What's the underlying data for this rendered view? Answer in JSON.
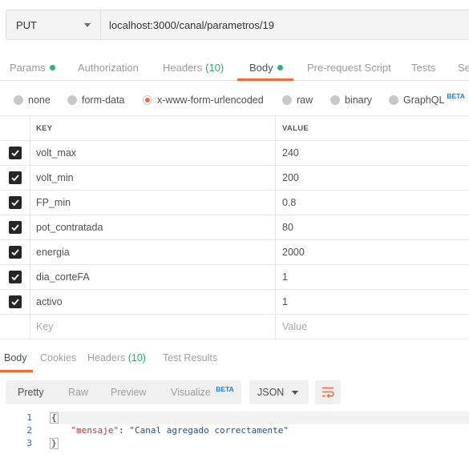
{
  "request": {
    "method": "PUT",
    "url": "localhost:3000/canal/parametros/19"
  },
  "request_tabs": [
    {
      "label": "Params",
      "dot": true
    },
    {
      "label": "Authorization"
    },
    {
      "label": "Headers",
      "count": "(10)"
    },
    {
      "label": "Body",
      "dot": true,
      "active": true
    },
    {
      "label": "Pre-request Script"
    },
    {
      "label": "Tests"
    },
    {
      "label": "Se"
    }
  ],
  "body_types": [
    {
      "label": "none"
    },
    {
      "label": "form-data"
    },
    {
      "label": "x-www-form-urlencoded",
      "selected": true
    },
    {
      "label": "raw"
    },
    {
      "label": "binary"
    },
    {
      "label": "GraphQL",
      "badge": "BETA"
    }
  ],
  "table": {
    "key_header": "KEY",
    "value_header": "VALUE",
    "rows": [
      {
        "key": "volt_max",
        "value": "240",
        "checked": true
      },
      {
        "key": "volt_min",
        "value": "200",
        "checked": true
      },
      {
        "key": "FP_min",
        "value": "0.8",
        "checked": true
      },
      {
        "key": "pot_contratada",
        "value": "80",
        "checked": true
      },
      {
        "key": "energia",
        "value": "2000",
        "checked": true
      },
      {
        "key": "dia_corteFA",
        "value": "1",
        "checked": true
      },
      {
        "key": "activo",
        "value": "1",
        "checked": true
      }
    ],
    "key_placeholder": "Key",
    "value_placeholder": "Value"
  },
  "response_tabs": [
    {
      "label": "Body",
      "active": true
    },
    {
      "label": "Cookies"
    },
    {
      "label": "Headers",
      "count": "(10)"
    },
    {
      "label": "Test Results"
    }
  ],
  "response_toolbar": {
    "views": [
      "Pretty",
      "Raw",
      "Preview",
      "Visualize"
    ],
    "visualize_badge": "BETA",
    "format": "JSON"
  },
  "response_body": {
    "line_numbers": [
      "1",
      "2",
      "3"
    ],
    "open": "{",
    "close": "}",
    "key": "\"mensaje\"",
    "colon": ": ",
    "value": "\"Canal agregado correctamente\""
  },
  "icons": {
    "method_caret": "chevron-down-icon",
    "checkbox": "check-icon",
    "wrap": "wrap-lines-icon",
    "format_caret": "chevron-down-icon"
  },
  "colors": {
    "accent": "#f26b3a",
    "dot_green": "#26b47f",
    "count_green": "#2eaa5f",
    "beta_blue": "#1a7fe0"
  }
}
